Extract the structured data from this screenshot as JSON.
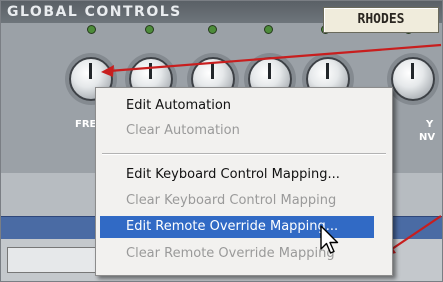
{
  "panel": {
    "title": "GLOBAL CONTROLS",
    "patch_name": "RHODES"
  },
  "knobs": {
    "labels": [
      "FRE",
      "Y",
      "NV"
    ]
  },
  "context_menu": {
    "items": [
      {
        "label": "Edit Automation",
        "state": "enabled"
      },
      {
        "label": "Clear Automation",
        "state": "disabled"
      },
      {
        "label": "Edit Keyboard Control Mapping...",
        "state": "enabled"
      },
      {
        "label": "Clear Keyboard Control Mapping",
        "state": "disabled"
      },
      {
        "label": "Edit Remote Override Mapping...",
        "state": "highlighted"
      },
      {
        "label": "Clear Remote Override Mapping",
        "state": "disabled"
      }
    ]
  },
  "colors": {
    "highlight": "#316ac5",
    "annotation_arrow": "#c81e1e",
    "menu_background": "#f2f1ef"
  },
  "icons": [
    "knob-icon",
    "led-icon",
    "arrow-cursor-icon"
  ]
}
